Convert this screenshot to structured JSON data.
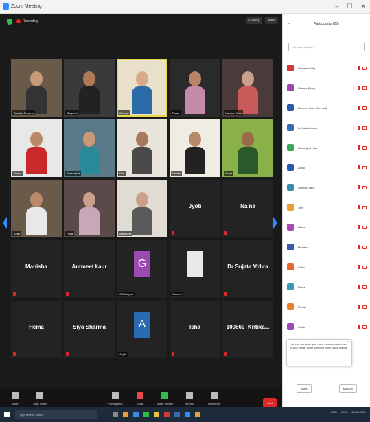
{
  "window": {
    "title": "Zoom Meeting",
    "controls": [
      "–",
      "☐",
      "✕"
    ]
  },
  "meeting": {
    "recording_label": "Recording",
    "view_buttons": [
      "Gallery",
      "View"
    ],
    "toolbar": [
      {
        "label": "Mute",
        "color": "#bbbbbb"
      },
      {
        "label": "Stop Video",
        "color": "#bbbbbb"
      },
      {
        "label": "Participants",
        "color": "#bbbbbb"
      },
      {
        "label": "Chat",
        "color": "#e24a4a"
      },
      {
        "label": "Share Screen",
        "color": "#2fbf4a"
      },
      {
        "label": "Record",
        "color": "#bbbbbb"
      },
      {
        "label": "Reactions",
        "color": "#bbbbbb"
      }
    ],
    "end_label": "End",
    "tiles": [
      {
        "type": "video",
        "name": "Anusha Sharma",
        "skin": "#c79a7a",
        "bg": "#6a5a4a",
        "shirt": "#333333"
      },
      {
        "type": "video",
        "name": "Gurpreet",
        "skin": "#b07a5a",
        "bg": "#3a3a3a",
        "shirt": "#222222"
      },
      {
        "type": "video",
        "name": "Bhavya",
        "skin": "#d9a98a",
        "bg": "#e8e0c8",
        "shirt": "#2a6aa8",
        "active": true
      },
      {
        "type": "video",
        "name": "Palak",
        "skin": "#b9846a",
        "bg": "#2a2a2a",
        "shirt": "#c48aa8"
      },
      {
        "type": "video",
        "name": "Navneet Kaur",
        "skin": "#c9a08a",
        "bg": "#4a3a3a",
        "shirt": "#c85a5a"
      },
      {
        "type": "video",
        "name": "Sneha",
        "skin": "#b98a6a",
        "bg": "#e8e8e8",
        "shirt": "#c82a2a"
      },
      {
        "type": "video",
        "name": "Simranjeet",
        "skin": "#c99a7a",
        "bg": "#5a7a8a",
        "shirt": "#2a8a9a"
      },
      {
        "type": "video",
        "name": "Kirti",
        "skin": "#a87a5a",
        "bg": "#e8e4dc",
        "shirt": "#4a4a4a"
      },
      {
        "type": "video",
        "name": "Mehak",
        "skin": "#b98a6a",
        "bg": "#f0ece4",
        "shirt": "#222222"
      },
      {
        "type": "video",
        "name": "Sumit",
        "skin": "#9a6a4a",
        "bg": "#8ab04a",
        "shirt": "#2a5a2a"
      },
      {
        "type": "video",
        "name": "Kiran",
        "skin": "#b98a6a",
        "bg": "#6a5a4a",
        "shirt": "#e8e8e8"
      },
      {
        "type": "video",
        "name": "Priya",
        "skin": "#c9a08a",
        "bg": "#5a4a4a",
        "shirt": "#c8a8b8"
      },
      {
        "type": "video",
        "name": "Manpreet",
        "skin": "#c9a08a",
        "bg": "#e0dcd4",
        "shirt": "#5a5a5a"
      },
      {
        "type": "name",
        "name": "Jyoti"
      },
      {
        "type": "name",
        "name": "Naina"
      },
      {
        "type": "name",
        "name": "Manisha"
      },
      {
        "type": "name",
        "name": "Antmeet kaur"
      },
      {
        "type": "avatar",
        "letter": "G",
        "name": "GS Gurjeet",
        "color": "#9a4ab0"
      },
      {
        "type": "logo",
        "name": "Sameer",
        "color": "#e8e8e8"
      },
      {
        "type": "name",
        "name": "Dr Sujata Vohra"
      },
      {
        "type": "name",
        "name": "Hema"
      },
      {
        "type": "name",
        "name": "Siya Sharma"
      },
      {
        "type": "avatar",
        "letter": "A",
        "name": "Anjali",
        "color": "#2a6ab0"
      },
      {
        "type": "name",
        "name": "Isha"
      },
      {
        "type": "name",
        "name": "100660_Kritika..."
      }
    ]
  },
  "panel": {
    "title": "Participants (26)",
    "search_placeholder": "Find a participant",
    "participants": [
      {
        "name": "Gurpreet (Me)",
        "color": "#d23a3a"
      },
      {
        "name": "Bhavya (Host)",
        "color": "#9a4ab0"
      },
      {
        "name": "Navneet Kaur (Co-host)",
        "color": "#2a5aa8"
      },
      {
        "name": "Dr Sujata Vohra",
        "color": "#3a6ab0"
      },
      {
        "name": "Simranjeet Kaur",
        "color": "#3aa85a"
      },
      {
        "name": "Anjali",
        "color": "#2a5aa8"
      },
      {
        "name": "Antmeet kaur",
        "color": "#3a8ab0"
      },
      {
        "name": "Siya",
        "color": "#e8a03a"
      },
      {
        "name": "Hema",
        "color": "#a84ab0"
      },
      {
        "name": "Manisha",
        "color": "#3a5aa8"
      },
      {
        "name": "Kritika",
        "color": "#e86a2a"
      },
      {
        "name": "Naina",
        "color": "#3a9ab0"
      },
      {
        "name": "Mehak",
        "color": "#e8802a"
      },
      {
        "name": "Palak",
        "color": "#9a4ab0"
      }
    ],
    "tooltip": "You can now share your name, pronouns and more in your profile. Hover over your name to see options.",
    "buttons": [
      "Invite",
      "Mute All"
    ]
  },
  "taskbar": {
    "search_placeholder": "Type here to search",
    "apps": [
      "#888888",
      "#e8a03a",
      "#3a8ae8",
      "#2fbf4a",
      "#e8c03a",
      "#d23a3a",
      "#3a6ab0",
      "#2d8cff",
      "#e8a03a"
    ],
    "tray": [
      "ENG",
      "11:26",
      "20-04-2021"
    ]
  }
}
